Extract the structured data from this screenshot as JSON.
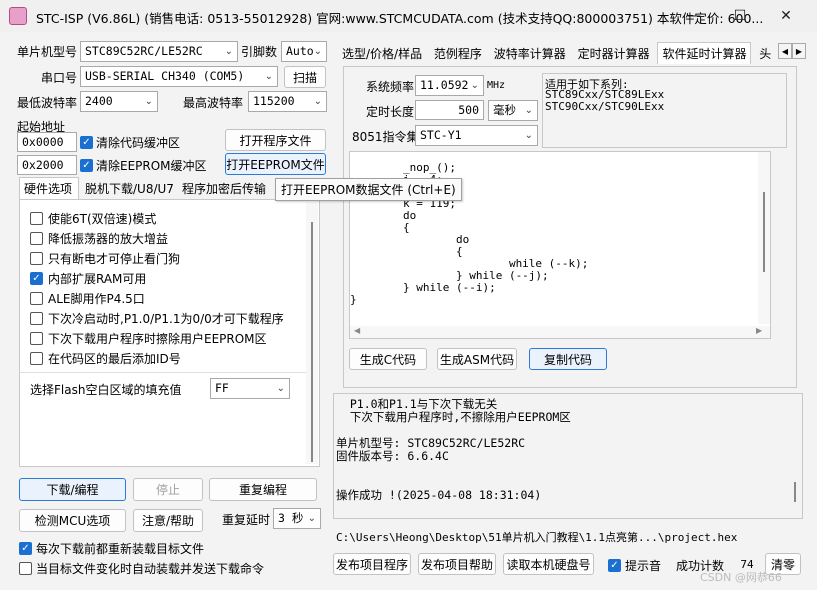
{
  "window": {
    "title": "STC-ISP (V6.86L) (销售电话: 0513-55012928) 官网:www.STCMCUDATA.com  (技术支持QQ:800003751) 本软件定价: 600..."
  },
  "left": {
    "mcu_label": "单片机型号",
    "mcu_value": "STC89C52RC/LE52RC",
    "pin_label": "引脚数",
    "pin_value": "Auto",
    "port_label": "串口号",
    "port_value": "USB-SERIAL CH340 (COM5)",
    "scan_label": "扫描",
    "min_baud_label": "最低波特率",
    "min_baud_value": "2400",
    "max_baud_label": "最高波特率",
    "max_baud_value": "115200",
    "start_addr_label": "起始地址",
    "code_addr": "0x0000",
    "clear_code_label": "清除代码缓冲区",
    "open_program_label": "打开程序文件",
    "eeprom_addr": "0x2000",
    "clear_eeprom_label": "清除EEPROM缓冲区",
    "open_eeprom_label": "打开EEPROM文件",
    "tabs": [
      "硬件选项",
      "脱机下载/U8/U7",
      "程序加密后传输"
    ],
    "options": [
      {
        "label": "使能6T(双倍速)模式",
        "checked": false
      },
      {
        "label": "降低振荡器的放大增益",
        "checked": false
      },
      {
        "label": "只有断电才可停止看门狗",
        "checked": false
      },
      {
        "label": "内部扩展RAM可用",
        "checked": true
      },
      {
        "label": "ALE脚用作P4.5口",
        "checked": false
      },
      {
        "label": "下次冷启动时,P1.0/P1.1为0/0才可下载程序",
        "checked": false
      },
      {
        "label": "下次下载用户程序时擦除用户EEPROM区",
        "checked": false
      },
      {
        "label": "在代码区的最后添加ID号",
        "checked": false
      }
    ],
    "fill_label": "选择Flash空白区域的填充值",
    "fill_value": "FF",
    "download_label": "下载/编程",
    "stop_label": "停止",
    "reprogram_label": "重复编程",
    "check_mcu_label": "检测MCU选项",
    "help_label": "注意/帮助",
    "delay_label": "重复延时",
    "delay_value": "3 秒",
    "reload_label": "每次下载前都重新装载目标文件",
    "reload_checked": true,
    "auto_load_label": "当目标文件变化时自动装载并发送下载命令",
    "auto_load_checked": false
  },
  "tooltip": "打开EEPROM数据文件 (Ctrl+E)",
  "right": {
    "tabs": [
      "选型/价格/样品",
      "范例程序",
      "波特率计算器",
      "定时器计算器",
      "软件延时计算器",
      "头"
    ],
    "freq_label": "系统频率",
    "freq_value": "11.0592",
    "freq_unit": "MHz",
    "series_label": "适用于如下系列:",
    "series_items": [
      "STC89Cxx/STC89LExx",
      "STC90Cxx/STC90LExx"
    ],
    "delay_len_label": "定时长度",
    "delay_len_value": "500",
    "delay_unit": "毫秒",
    "instr_label": "8051指令集",
    "instr_value": "STC-Y1",
    "code_lines": [
      "        _nop_();",
      "        i = 4;",
      "        j = 129;",
      "        k = 119;",
      "        do",
      "        {",
      "                do",
      "                {",
      "                        while (--k);",
      "                } while (--j);",
      "        } while (--i);",
      "}"
    ],
    "gen_c_label": "生成C代码",
    "gen_asm_label": "生成ASM代码",
    "copy_label": "复制代码",
    "log_lines": [
      "  P1.0和P1.1与下次下载无关",
      "  下次下载用户程序时,不擦除用户EEPROM区",
      "",
      "单片机型号: STC89C52RC/LE52RC",
      "固件版本号: 6.6.4C",
      "",
      "",
      "操作成功 !(2025-04-08 18:31:04)"
    ],
    "path": "C:\\Users\\Heong\\Desktop\\51单片机入门教程\\1.1点亮第...\\project.hex",
    "publish_label": "发布项目程序",
    "publish_help_label": "发布项目帮助",
    "read_disk_label": "读取本机硬盘号",
    "beep_label": "提示音",
    "beep_checked": true,
    "count_label": "成功计数",
    "count_value": "74",
    "clear_label": "清零"
  },
  "watermark": "CSDN @网恭66"
}
